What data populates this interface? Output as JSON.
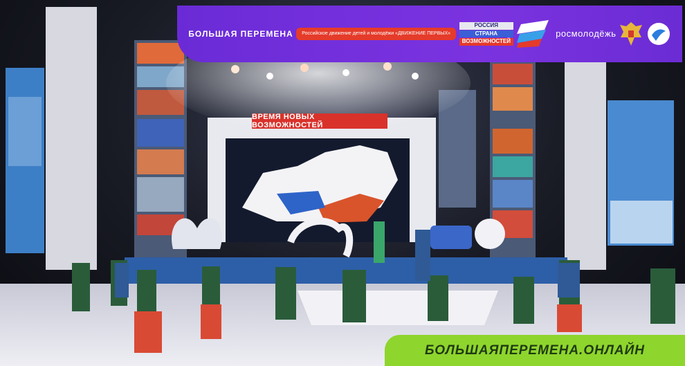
{
  "header_logos": {
    "bolshaya_peremena": "БОЛЬШАЯ ПЕРЕМЕНА",
    "dvizhenie_pervyh": "Российское движение детей и молодёжи «ДВИЖЕНИЕ ПЕРВЫХ»",
    "rsv": [
      "РОССИЯ",
      "СТРАНА",
      "ВОЗМОЖНОСТЕЙ"
    ],
    "rosmolodezh": "росмолодёжь"
  },
  "stage_banner": "ВРЕМЯ НОВЫХ ВОЗМОЖНОСТЕЙ",
  "footer_text": "БОЛЬШАЯПЕРЕМЕНА.ОНЛАЙН",
  "colors": {
    "header_purple": "#7b33e0",
    "footer_green": "#8ed52e",
    "banner_red": "#d9322b"
  }
}
